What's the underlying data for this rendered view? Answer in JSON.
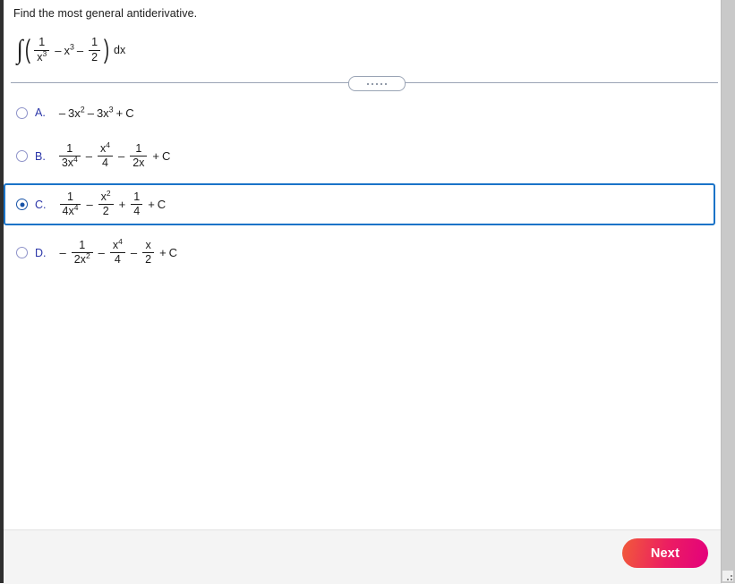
{
  "question": {
    "prompt": "Find the most general antiderivative.",
    "expression_text": "∫ ( 1/x^3 - x^3 - 1/2 ) dx",
    "integral_symbol": "∫",
    "paren_open": "(",
    "paren_close": ")",
    "differential": "dx",
    "terms": {
      "t1_num": "1",
      "t1_den_base": "x",
      "t1_den_exp": "3",
      "op1": "–",
      "t2_base": "x",
      "t2_exp": "3",
      "op2": "–",
      "t3_num": "1",
      "t3_den": "2"
    }
  },
  "divider": {
    "handle_dots": 5
  },
  "choices": [
    {
      "letter": "A.",
      "selected": false,
      "expression_text": "– 3x^2 – 3x^3 + C",
      "parts": {
        "lead_minus": "–",
        "c1": "3x",
        "c1_exp": "2",
        "op1": "–",
        "c2": "3x",
        "c2_exp": "3",
        "op2": "+",
        "constant": "C"
      }
    },
    {
      "letter": "B.",
      "selected": false,
      "expression_text": "1/(3x^4) – x^4/4 – 1/(2x) + C",
      "parts": {
        "f1_num": "1",
        "f1_den": "3x",
        "f1_den_exp": "4",
        "op1": "–",
        "f2_num": "x",
        "f2_num_exp": "4",
        "f2_den": "4",
        "op2": "–",
        "f3_num": "1",
        "f3_den": "2x",
        "op3": "+",
        "constant": "C"
      }
    },
    {
      "letter": "C.",
      "selected": true,
      "expression_text": "1/(4x^4) – x^2/2 + 1/4 + C",
      "parts": {
        "f1_num": "1",
        "f1_den": "4x",
        "f1_den_exp": "4",
        "op1": "–",
        "f2_num": "x",
        "f2_num_exp": "2",
        "f2_den": "2",
        "op2": "+",
        "f3_num": "1",
        "f3_den": "4",
        "op3": "+",
        "constant": "C"
      }
    },
    {
      "letter": "D.",
      "selected": false,
      "expression_text": "– 1/(2x^2) – x^4/4 – x/2 + C",
      "parts": {
        "lead_minus": "–",
        "f1_num": "1",
        "f1_den": "2x",
        "f1_den_exp": "2",
        "op1": "–",
        "f2_num": "x",
        "f2_num_exp": "4",
        "f2_den": "4",
        "op2": "–",
        "f3_num": "x",
        "f3_den": "2",
        "op3": "+",
        "constant": "C"
      }
    }
  ],
  "footer": {
    "next_label": "Next"
  },
  "colors": {
    "choice_letter": "#2a35a8",
    "selected_border": "#1a73c8",
    "radio_fill": "#1753a8",
    "next_gradient_start": "#f15a3a",
    "next_gradient_end": "#e3007d",
    "divider_line": "#9aa4b5"
  }
}
